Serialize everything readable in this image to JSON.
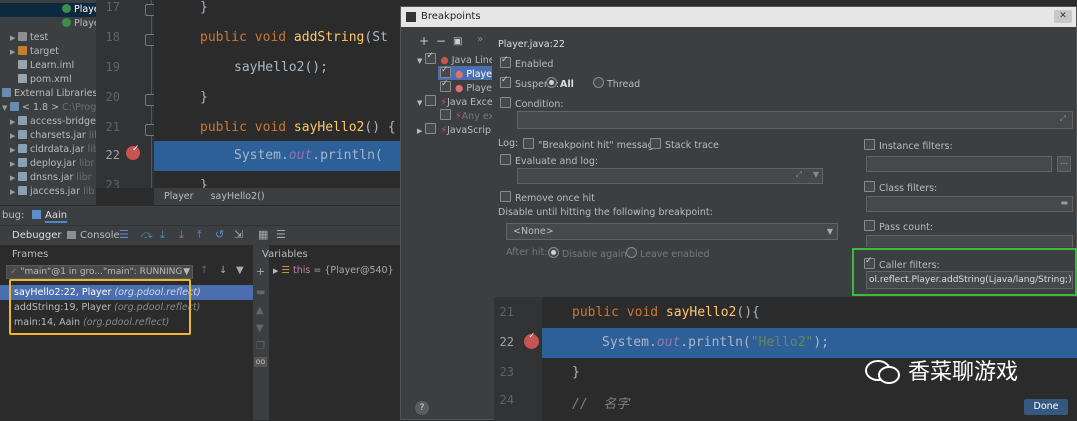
{
  "project_tree": {
    "items": [
      {
        "label": "Player",
        "kind": "class",
        "selected": true
      },
      {
        "label": "Player",
        "kind": "class",
        "selected": false
      },
      {
        "label": "test",
        "kind": "folder"
      },
      {
        "label": "target",
        "kind": "folder-orange"
      },
      {
        "label": "Learn.iml",
        "kind": "file"
      },
      {
        "label": "pom.xml",
        "kind": "file"
      },
      {
        "label": "External Libraries",
        "kind": "lib"
      },
      {
        "label": "< 1.8 >",
        "suffix": "C:\\Progra",
        "kind": "lib"
      },
      {
        "label": "access-bridge-",
        "kind": "jar"
      },
      {
        "label": "charsets.jar",
        "suffix": "libr",
        "kind": "jar"
      },
      {
        "label": "cldrdata.jar",
        "suffix": "lib",
        "kind": "jar"
      },
      {
        "label": "deploy.jar",
        "suffix": "libr",
        "kind": "jar"
      },
      {
        "label": "dnsns.jar",
        "suffix": "libr",
        "kind": "jar"
      },
      {
        "label": "jaccess.jar",
        "suffix": "lib",
        "kind": "jar"
      }
    ]
  },
  "editor": {
    "line_numbers": [
      "17",
      "18",
      "19",
      "20",
      "21",
      "22",
      "23"
    ],
    "lines": {
      "l17": "}",
      "l18_kw": "public void ",
      "l18_fn": "addString",
      "l18_rest": "(St",
      "l19": "sayHello2();",
      "l20": "}",
      "l21_kw": "public void ",
      "l21_fn": "sayHello2",
      "l21_rest": "() {",
      "l22_a": "System.",
      "l22_out": "out",
      "l22_b": ".println(",
      "l23": "}"
    },
    "breadcrumb": [
      "Player",
      "sayHello2()"
    ]
  },
  "debug": {
    "header_label": "bug:",
    "config_name": "Aain",
    "tabs": {
      "debugger": "Debugger",
      "console": "Console"
    },
    "frames_label": "Frames",
    "variables_label": "Variables",
    "thread_select": "\"main\"@1 in gro...\"main\": RUNNING",
    "frames": [
      {
        "method": "sayHello2:22, Player",
        "pkg": "(org.pdool.reflect)",
        "selected": true
      },
      {
        "method": "addString:19, Player",
        "pkg": "(org.pdool.reflect)",
        "selected": false
      },
      {
        "method": "main:14, Aain",
        "pkg": "(org.pdool.reflect)",
        "selected": false
      }
    ],
    "variable": {
      "name": "this",
      "value": "= {Player@540}"
    }
  },
  "dialog": {
    "title": "Breakpoints",
    "tree": {
      "java_line": "Java Line",
      "player1": "Player",
      "player2": "Player",
      "java_exc": "Java Exce",
      "any_exc": "Any ex",
      "javascript": "JavaScrip"
    },
    "header": "Player.java:22",
    "enabled": "Enabled",
    "suspend": "Suspend:",
    "suspend_all": "All",
    "suspend_thread": "Thread",
    "condition": "Condition:",
    "log": "Log:",
    "log_message": "\"Breakpoint hit\" message",
    "stack_trace": "Stack trace",
    "evaluate_log": "Evaluate and log:",
    "remove_once": "Remove once hit",
    "disable_until": "Disable until hitting the following breakpoint:",
    "none_option": "<None>",
    "after_hit": "After hit:",
    "disable_again": "Disable again",
    "leave_enabled": "Leave enabled",
    "instance_filters": "Instance filters:",
    "class_filters": "Class filters:",
    "pass_count": "Pass count:",
    "caller_filters": "Caller filters:",
    "caller_value": "ol.reflect.Player.addString(Ljava/lang/String;)V",
    "code": {
      "n21": "21",
      "n22": "22",
      "n23": "23",
      "n24": "24",
      "l21_kw": "public void ",
      "l21_fn": "sayHello2",
      "l21_rest": "(){",
      "l22_a": "System.",
      "l22_out": "out",
      "l22_b": ".println(",
      "l22_str": "\"Hello2\"",
      "l22_c": ");",
      "l23": "}",
      "l24": "//  名字"
    },
    "done": "Done",
    "help": "?"
  },
  "watermark": "香菜聊游戏",
  "colors": {
    "accent_green": "#3fb83f",
    "accent_yellow": "#f0b92c",
    "selection": "#2d5f99"
  }
}
